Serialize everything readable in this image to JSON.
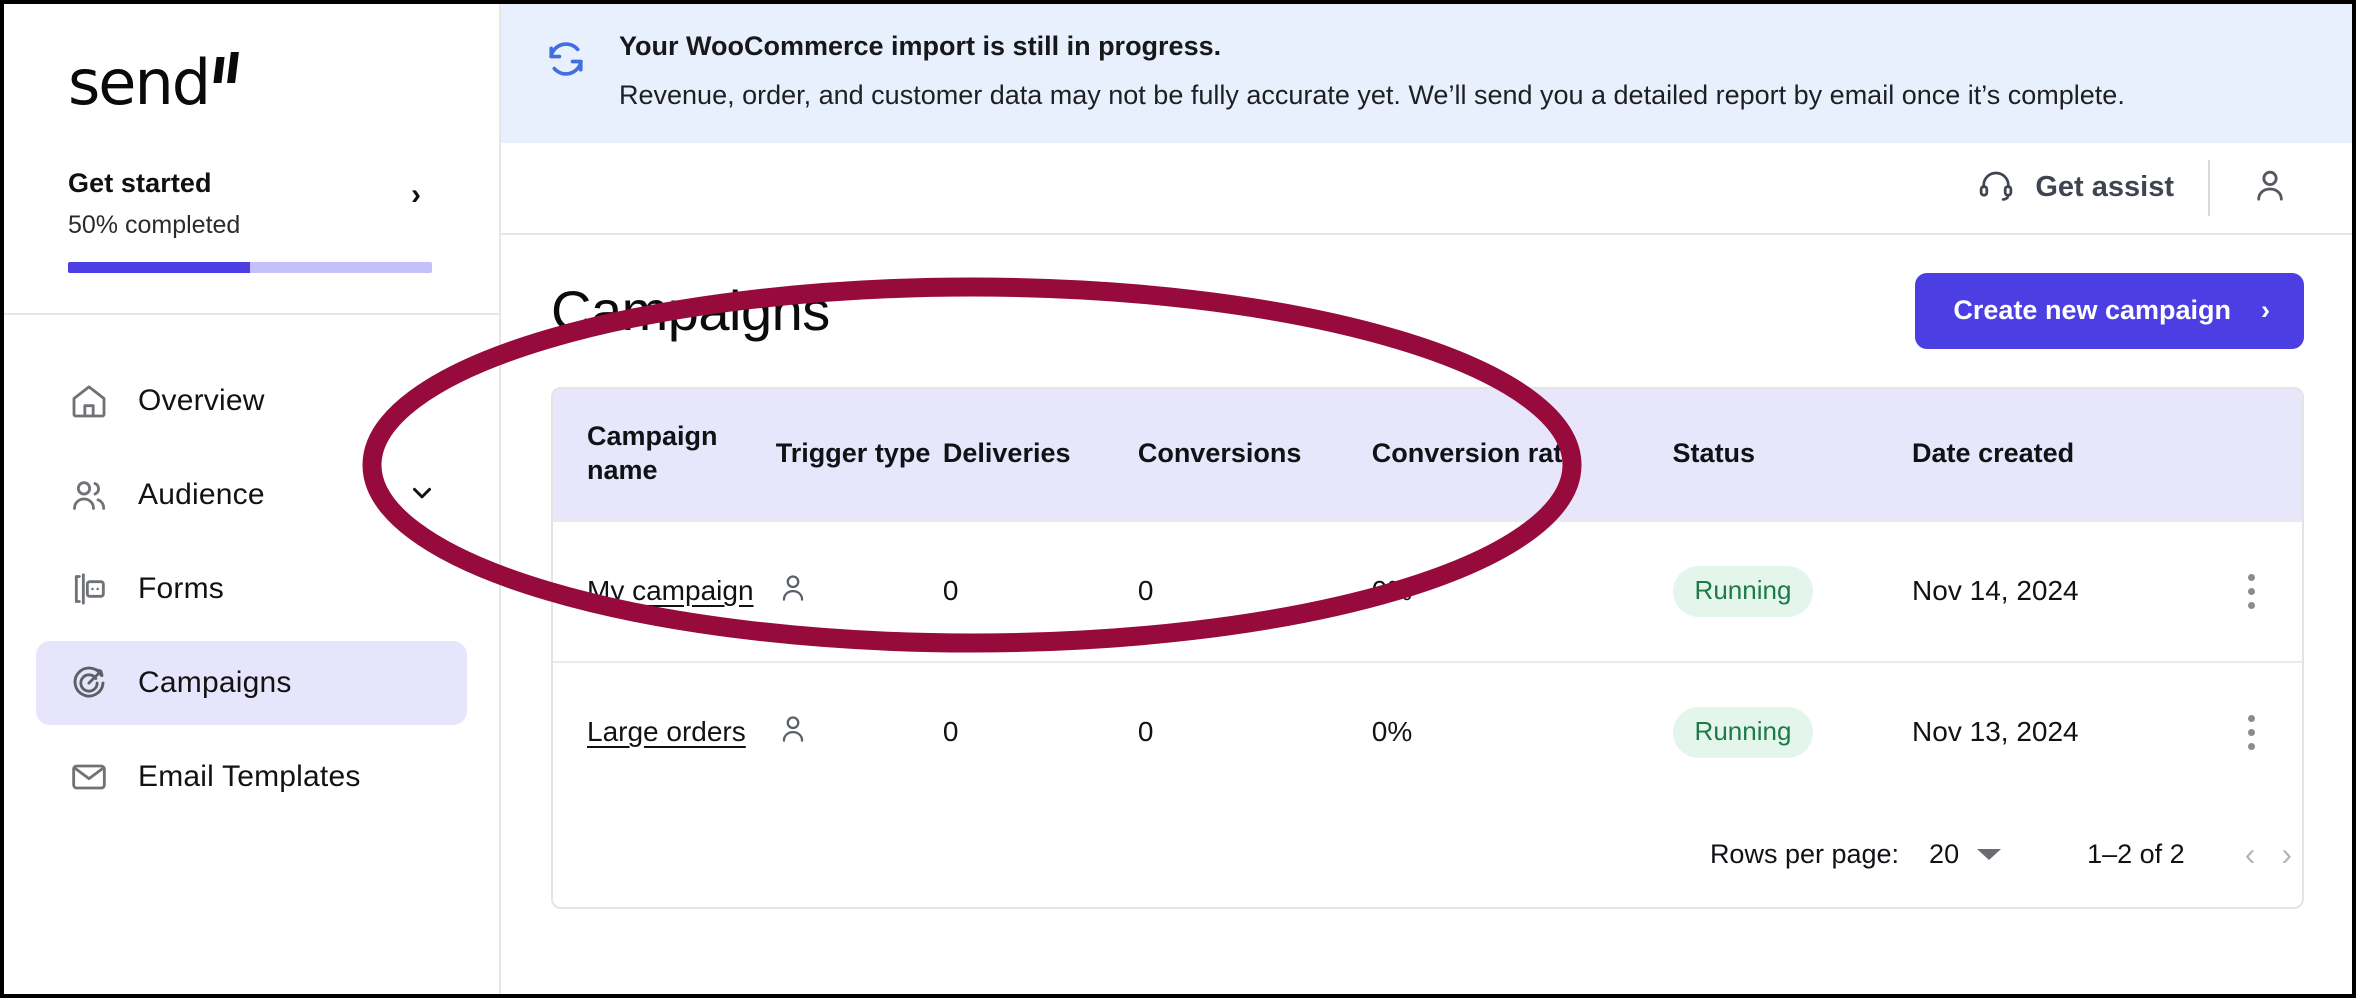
{
  "brand": {
    "name": "send"
  },
  "sidebar": {
    "get_started": {
      "title": "Get started",
      "subtitle": "50% completed",
      "progress_percent": 50,
      "chevron": "chevron-right-icon"
    },
    "items": [
      {
        "label": "Overview",
        "icon": "home-icon",
        "active": false,
        "expandable": false
      },
      {
        "label": "Audience",
        "icon": "users-icon",
        "active": false,
        "expandable": true
      },
      {
        "label": "Forms",
        "icon": "form-icon",
        "active": false,
        "expandable": false
      },
      {
        "label": "Campaigns",
        "icon": "target-icon",
        "active": true,
        "expandable": false
      },
      {
        "label": "Email Templates",
        "icon": "envelope-icon",
        "active": false,
        "expandable": false
      }
    ]
  },
  "banner": {
    "icon": "sync-icon",
    "headline": "Your WooCommerce import is still in progress.",
    "body": "Revenue, order, and customer data may not be fully accurate yet. We’ll send you a detailed report by email once it’s complete.",
    "background_color": "#e9f0fd",
    "icon_color": "#3f6fe0"
  },
  "topbar": {
    "assist_label": "Get assist",
    "assist_icon": "headset-icon",
    "account_icon": "user-circle-icon"
  },
  "page": {
    "title": "Campaigns",
    "create_button_label": "Create new campaign",
    "create_button_chevron": "chevron-right-icon",
    "create_button_color": "#4b3fe4"
  },
  "table": {
    "columns": [
      {
        "label": "Campaign name",
        "key": "name"
      },
      {
        "label": "Trigger type",
        "key": "trigger"
      },
      {
        "label": "Deliveries",
        "key": "deliveries"
      },
      {
        "label": "Conversions",
        "key": "conversions"
      },
      {
        "label": "Conversion rate",
        "key": "rate"
      },
      {
        "label": "Status",
        "key": "status"
      },
      {
        "label": "Date created",
        "key": "date"
      }
    ],
    "header_background": "#e8e6fa",
    "rows": [
      {
        "name": "My campaign",
        "trigger_icon": "person-icon",
        "deliveries": "0",
        "conversions": "0",
        "rate": "0%",
        "status": "Running",
        "date": "Nov 14, 2024",
        "menu_icon": "kebab-menu-icon"
      },
      {
        "name": "Large orders",
        "trigger_icon": "person-icon",
        "deliveries": "0",
        "conversions": "0",
        "rate": "0%",
        "status": "Running",
        "date": "Nov 13, 2024",
        "menu_icon": "kebab-menu-icon"
      }
    ],
    "status_colors": {
      "running_bg": "#e4f6ec",
      "running_text": "#1c7a48"
    }
  },
  "pagination": {
    "rows_per_page_label": "Rows per page:",
    "rows_per_page_value": "20",
    "range_label": "1–2 of 2",
    "prev_icon": "chevron-left-icon",
    "next_icon": "chevron-right-icon"
  },
  "annotation": {
    "shape": "ellipse-highlight",
    "color": "#970a3c"
  }
}
